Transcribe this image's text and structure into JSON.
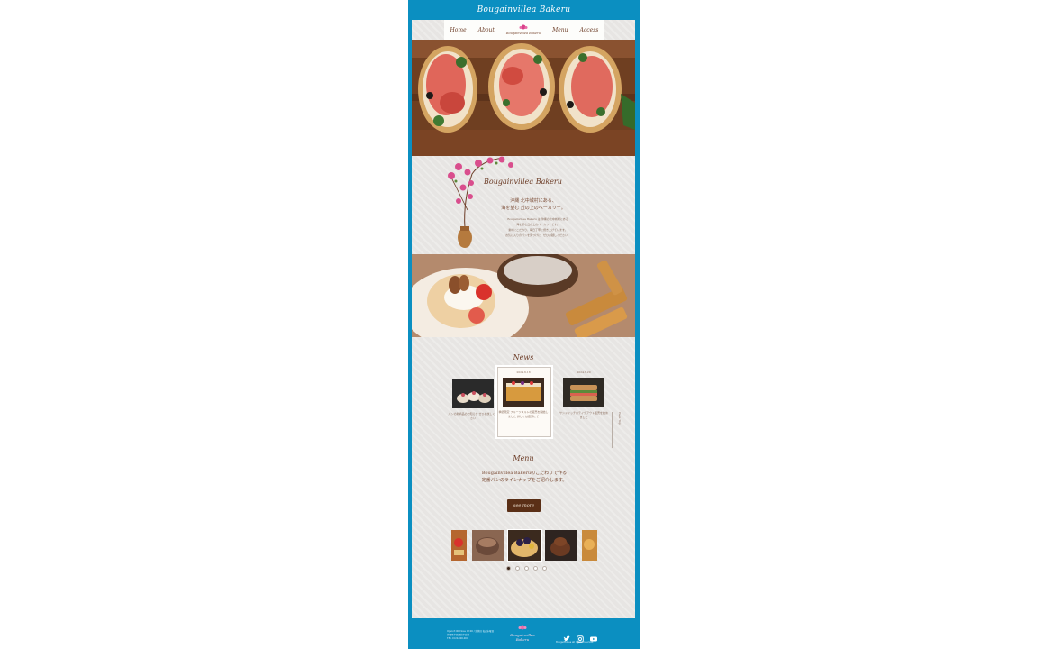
{
  "site": {
    "title": "Bougainvillea Bakeru"
  },
  "nav": {
    "items": [
      "Home",
      "About",
      "Menu",
      "Access"
    ],
    "logo": "Bougainvillea Bakeru"
  },
  "intro": {
    "brand": "Bougainvillea Bakeru",
    "lead_line1": "沖縄 北中城村にある、",
    "lead_line2": "海を望む 丘の上のベーカリー。",
    "body": [
      "Bougainvillea Bakeru は 沖縄の北中城村にある",
      "海を望む丘の上のベーカリーです。",
      "素材にこだわり、毎日丁寧に焼き上げています。",
      "お気に入りのパンを見つけに、ぜひお越しください。"
    ]
  },
  "news": {
    "title": "News",
    "items": [
      {
        "date": "",
        "text": "パンの新商品のお知らせ ぜひお試しください"
      },
      {
        "date": "2024.6.18",
        "text": "季節限定 フルーツタルトの販売を開始しました 詳しくは店頭にて"
      },
      {
        "date": "2024.6.20",
        "text": "サンドイッチのテイクアウト販売を始めました"
      }
    ],
    "page_top": "Page Top"
  },
  "menu": {
    "title": "Menu",
    "lead_line1": "Bougainvillea Bakeruのこだわりで作る",
    "lead_line2": "定番パンのラインナップをご紹介します。",
    "see_more": "see more"
  },
  "footer": {
    "address": "Open 8:00 Close 18:00 / 定休日 毎週水曜日",
    "address2": "沖縄県中頭郡北中城村",
    "phone": "TEL 0120-000-000",
    "logo": "Bougainvillea Bakeru",
    "copyright": "Bougainvillea all rights reserved"
  },
  "colors": {
    "frame": "#0b8fc1",
    "accent_brown": "#6b3b25",
    "button": "#5a2f16"
  },
  "icons": [
    "twitter-icon",
    "instagram-icon",
    "youtube-icon"
  ]
}
